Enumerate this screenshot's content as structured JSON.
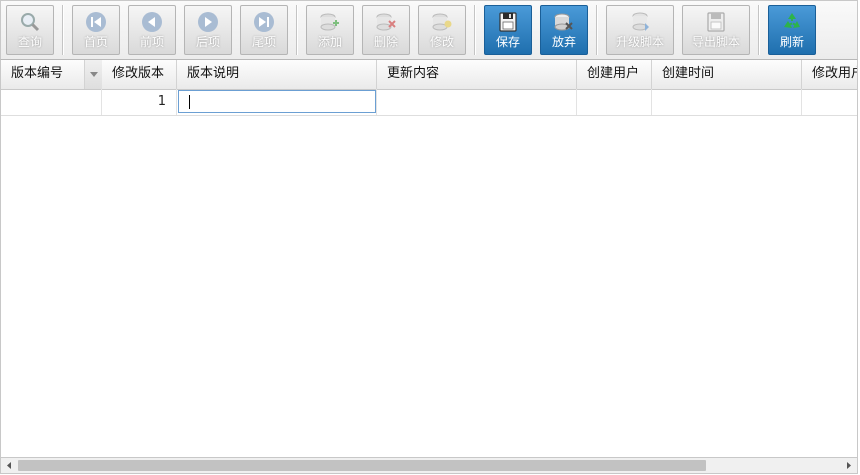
{
  "toolbar": {
    "query": "查询",
    "first": "首页",
    "prev": "前项",
    "next": "后项",
    "last": "尾项",
    "add": "添加",
    "delete": "删除",
    "edit": "修改",
    "save": "保存",
    "discard": "放弃",
    "upgrade_script": "升级脚本",
    "export_script": "导出脚本",
    "refresh": "刷新"
  },
  "grid": {
    "columns": [
      "版本编号",
      "修改版本",
      "版本说明",
      "更新内容",
      "创建用户",
      "创建时间",
      "修改用户"
    ],
    "rows": [
      {
        "version_no": "",
        "revision": "1",
        "description": "",
        "content": "",
        "creator": "",
        "created_at": "",
        "modifier": ""
      }
    ]
  },
  "colors": {
    "accent_blue": "#2a7bbd",
    "refresh_icon": "#1e9a3a"
  }
}
